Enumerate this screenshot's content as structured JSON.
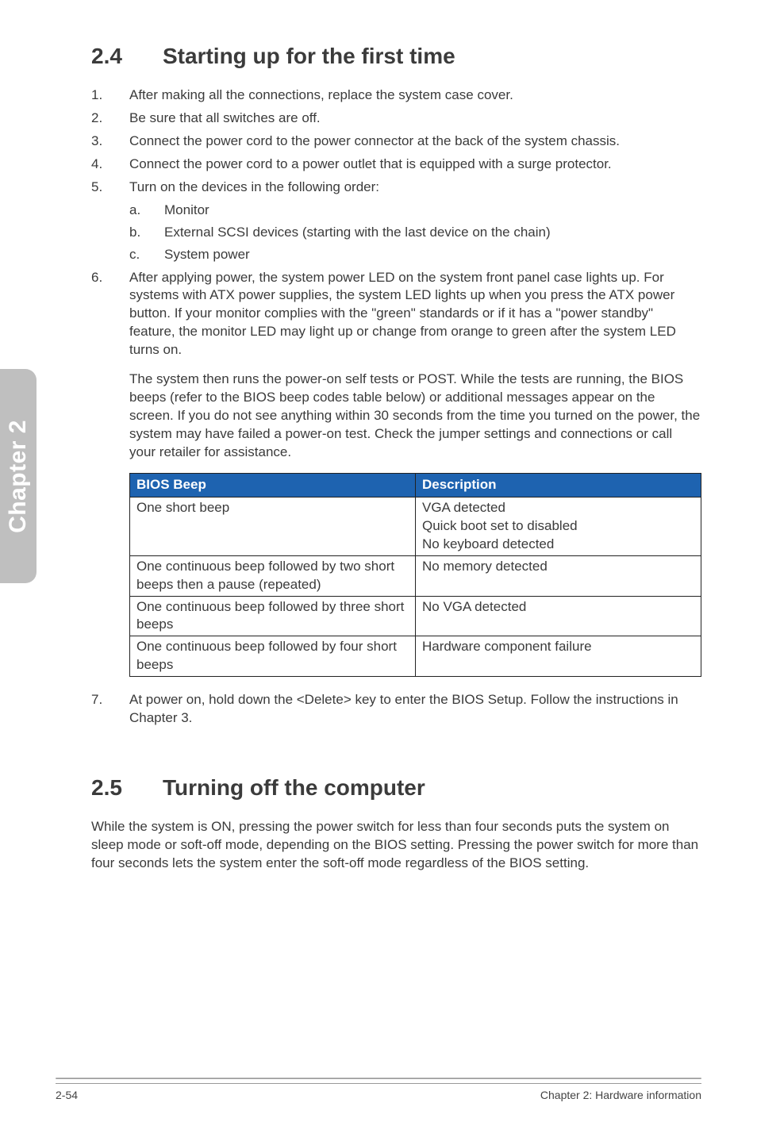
{
  "sidebar": {
    "label": "Chapter 2"
  },
  "section24": {
    "number": "2.4",
    "title": "Starting up for the first time",
    "steps": [
      "After making all the connections, replace the system case cover.",
      "Be sure that all switches are off.",
      "Connect the power cord to the power connector at the back of the system chassis.",
      "Connect the power cord to a power outlet that is equipped with a surge protector.",
      "Turn on the devices in the following order:"
    ],
    "substeps": [
      {
        "letter": "a.",
        "text": "Monitor"
      },
      {
        "letter": "b.",
        "text": "External SCSI devices (starting with the last device on the chain)"
      },
      {
        "letter": "c.",
        "text": "System power"
      }
    ],
    "step6_para1": "After applying power, the system power LED on the system front panel case lights up. For systems with ATX power supplies, the system LED lights up when you press the ATX power button. If your monitor complies with the \"green\" standards or if it has a \"power standby\" feature, the monitor LED may light up or change from orange to green after the system LED turns on.",
    "step6_para2": "The system then runs the power-on self tests or POST. While the tests are running, the BIOS beeps (refer to the BIOS beep codes table below) or additional messages appear on the screen. If you do not see anything within 30 seconds from the time you turned on the power, the system may have failed a power-on test. Check the jumper settings and connections or call your retailer for assistance.",
    "table": {
      "headers": [
        "BIOS Beep",
        "Description"
      ],
      "rows": [
        [
          "One short beep",
          "VGA detected\nQuick boot set to disabled\nNo keyboard detected"
        ],
        [
          "One continuous beep followed by two short beeps then a pause (repeated)",
          "No memory detected"
        ],
        [
          "One continuous beep followed by three short beeps",
          "No VGA detected"
        ],
        [
          "One continuous beep followed by four short beeps",
          "Hardware component failure"
        ]
      ]
    },
    "step7_num": "7.",
    "step7": "At power on, hold down the <Delete> key to enter the BIOS Setup. Follow the instructions in Chapter 3."
  },
  "section25": {
    "number": "2.5",
    "title": "Turning off the computer",
    "body": "While the system is ON, pressing the power switch for less than four seconds puts the system on sleep mode or soft-off mode, depending on the BIOS setting. Pressing the power switch for more than four seconds lets the system enter the soft-off mode regardless of the BIOS setting."
  },
  "footer": {
    "left": "2-54",
    "right": "Chapter 2: Hardware information"
  }
}
